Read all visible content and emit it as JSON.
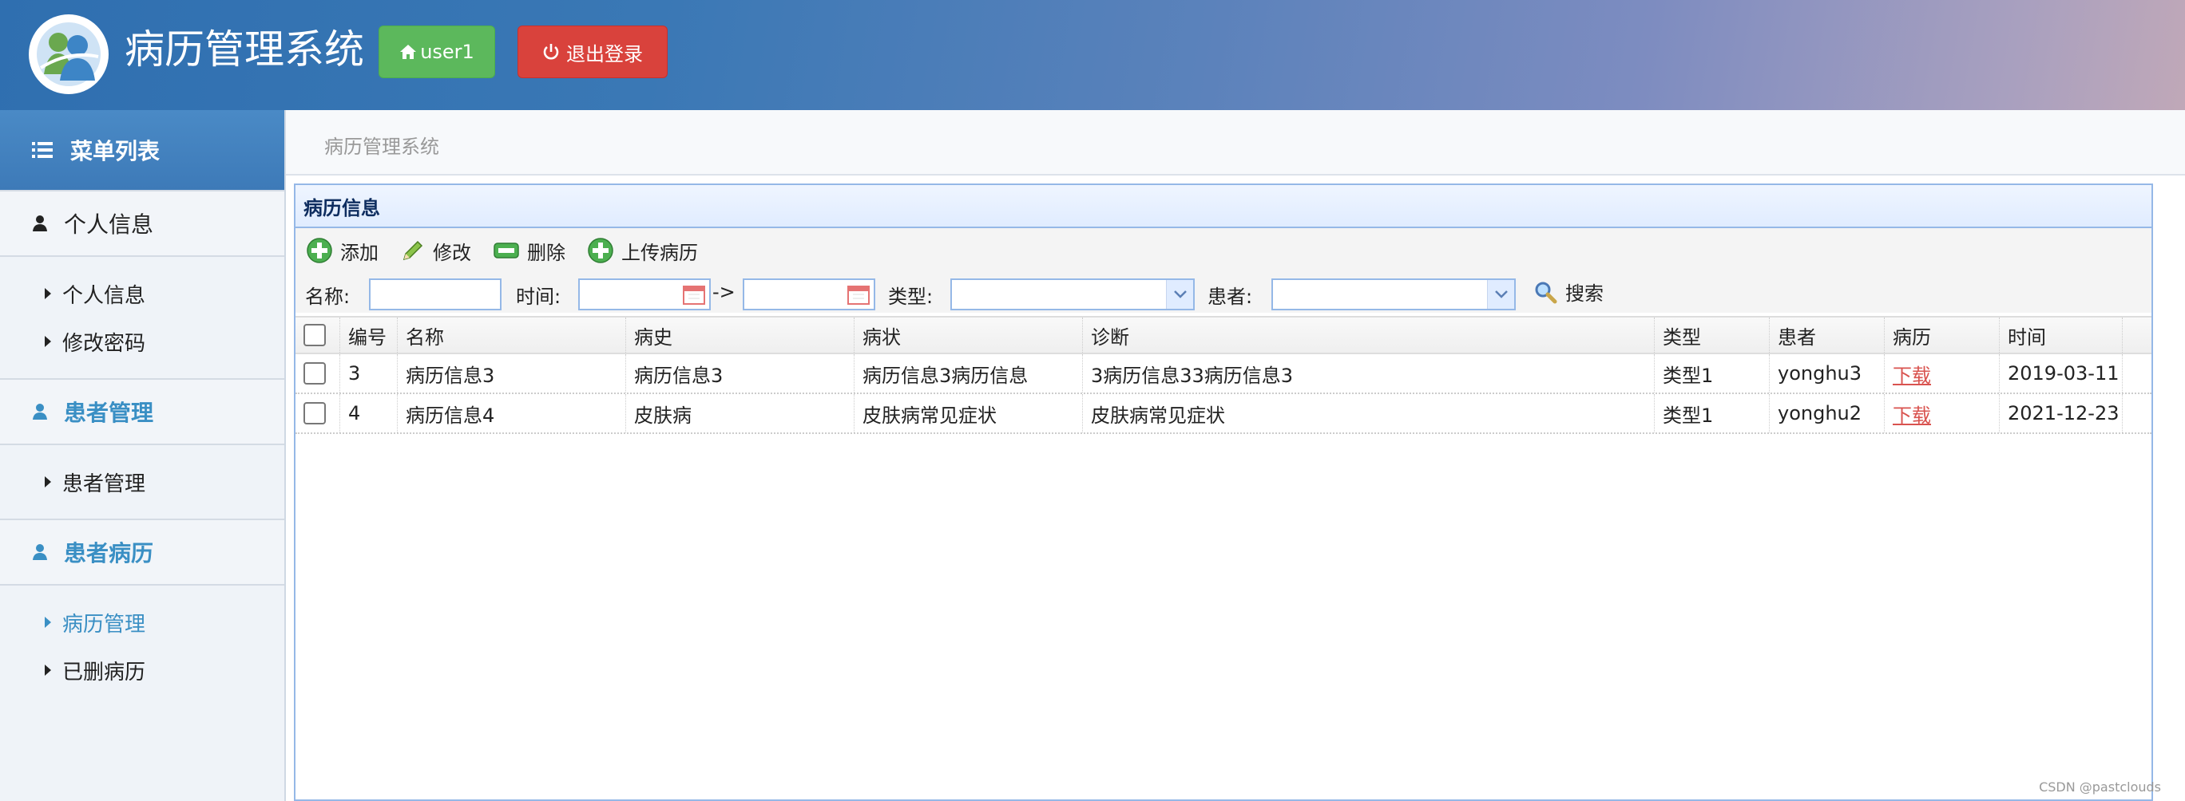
{
  "header": {
    "title": "病历管理系统",
    "user_button": "user1",
    "logout_button": "退出登录"
  },
  "sidebar": {
    "menu_title": "菜单列表",
    "groups": [
      {
        "title": "个人信息",
        "items": [
          "个人信息",
          "修改密码"
        ]
      },
      {
        "title": "患者管理",
        "items": [
          "患者管理"
        ]
      },
      {
        "title": "患者病历",
        "items": [
          "病历管理",
          "已删病历"
        ]
      }
    ],
    "active_item": "病历管理"
  },
  "breadcrumb": "病历管理系统",
  "panel": {
    "title": "病历信息",
    "toolbar": {
      "add": "添加",
      "edit": "修改",
      "delete": "删除",
      "upload": "上传病历"
    },
    "search": {
      "name_label": "名称:",
      "time_label": "时间:",
      "arrow": "->",
      "type_label": "类型:",
      "patient_label": "患者:",
      "search_button": "搜索"
    },
    "columns": [
      "编号",
      "名称",
      "病史",
      "病状",
      "诊断",
      "类型",
      "患者",
      "病历",
      "时间"
    ],
    "rows": [
      {
        "id": "3",
        "name": "病历信息3",
        "history": "病历信息3",
        "symptom": "病历信息3病历信息",
        "diagnosis": "3病历信息33病历信息3",
        "type": "类型1",
        "patient": "yonghu3",
        "record": "下载",
        "time": "2019-03-11"
      },
      {
        "id": "4",
        "name": "病历信息4",
        "history": "皮肤病",
        "symptom": "皮肤病常见症状",
        "diagnosis": "皮肤病常见症状",
        "type": "类型1",
        "patient": "yonghu2",
        "record": "下载",
        "time": "2021-12-23"
      }
    ]
  },
  "watermark": "CSDN @pastclouds",
  "colors": {
    "accent_blue": "#3a8fc4",
    "user_button": "#5cb85c",
    "logout_button": "#d9423c",
    "panel_border": "#95b8e7"
  }
}
